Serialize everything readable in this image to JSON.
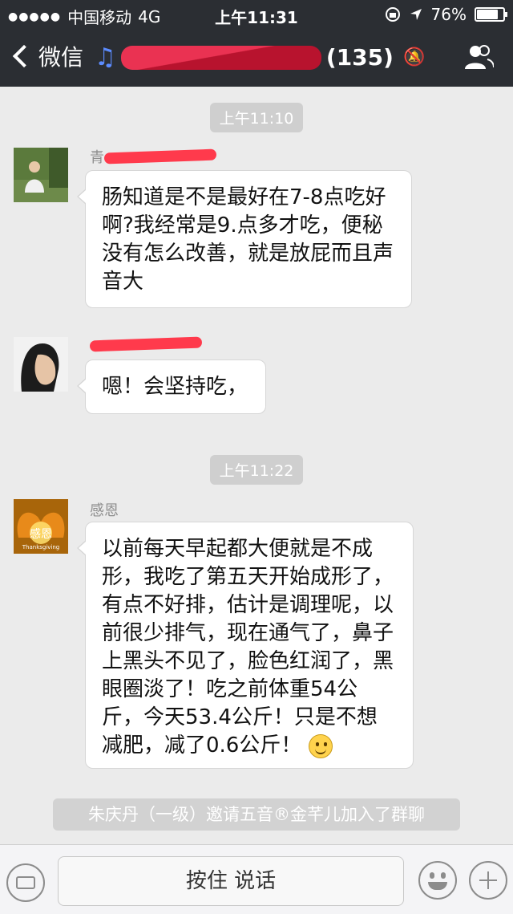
{
  "status_bar": {
    "signal": "●●●●●",
    "carrier": "中国移动",
    "network": "4G",
    "time": "上午11:31",
    "battery": "76%",
    "battery_level": 0.76
  },
  "nav": {
    "back_label": "微信",
    "group_count": "(135)"
  },
  "chat": {
    "timestamps": [
      "上午11:10",
      "上午11:22"
    ],
    "messages": [
      {
        "sender_visible": "青",
        "text": "肠知道是不是最好在7-8点吃好啊?我经常是9.点多才吃，便秘没有怎么改善，就是放屁而且声音大"
      },
      {
        "text": "嗯！会坚持吃，"
      },
      {
        "sender": "感恩",
        "avatar_caption": "感恩",
        "avatar_subcaption": "Thanksgiving",
        "text": "以前每天早起都大便就是不成形，我吃了第五天开始成形了，有点不好排，估计是调理呢，以前很少排气，现在通气了，鼻子上黑头不见了，脸色红润了，黑眼圈淡了！吃之前体重54公斤，今天53.4公斤！只是不想减肥，减了0.6公斤！"
      }
    ],
    "system_message": "朱庆丹（一级）邀请五音®金芊儿加入了群聊"
  },
  "input": {
    "talk_label": "按住 说话"
  },
  "colors": {
    "bar_bg": "#2b2e33",
    "chat_bg": "#ebebeb",
    "redaction": "#ff3355"
  }
}
